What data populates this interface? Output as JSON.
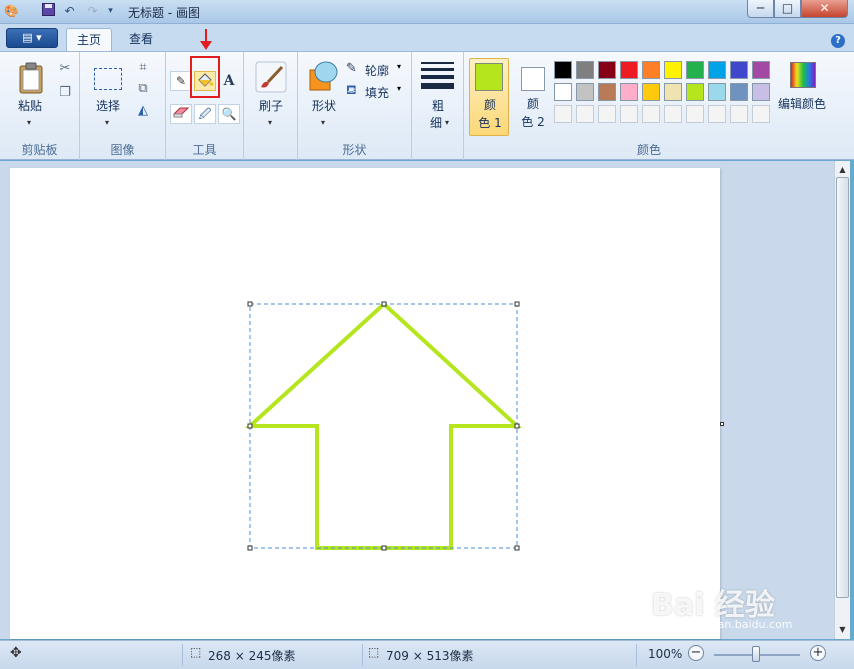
{
  "window": {
    "title": "无标题 - 画图",
    "min_glyph": "─",
    "max_glyph": "□",
    "close_glyph": "✕"
  },
  "quick_access": {
    "icons": [
      "paint-logo-icon",
      "save-icon",
      "undo-icon",
      "redo-icon",
      "dropdown-icon"
    ]
  },
  "tabs": {
    "app_menu": "▤ ▾",
    "home": "主页",
    "view": "查看",
    "help": "?"
  },
  "ribbon": {
    "clipboard": {
      "paste": "粘贴",
      "label": "剪贴板"
    },
    "image": {
      "select": "选择",
      "label": "图像"
    },
    "tools": {
      "label": "工具",
      "text_glyph": "A"
    },
    "brushes": {
      "label": "刷子"
    },
    "shapes": {
      "shapes_label": "形状",
      "outline": "轮廓",
      "fill": "填充",
      "group_label": "形状"
    },
    "size": {
      "label_line1": "粗",
      "label_line2": "细"
    },
    "colors": {
      "color1_line1": "颜",
      "color1_line2": "色 1",
      "color2_line1": "颜",
      "color2_line2": "色 2",
      "edit_colors": "编辑颜色",
      "group_label": "颜色",
      "color1_value": "#b5e61d",
      "color2_value": "#ffffff",
      "palette_row1": [
        "#000000",
        "#7f7f7f",
        "#880015",
        "#ed1c24",
        "#ff7f27",
        "#fff200",
        "#22b14c",
        "#00a2e8",
        "#3f48cc",
        "#a349a4"
      ],
      "palette_row2": [
        "#ffffff",
        "#c3c3c3",
        "#b97a57",
        "#ffaec9",
        "#ffc90e",
        "#efe4b0",
        "#b5e61d",
        "#99d9ea",
        "#7092be",
        "#c8bfe7"
      ],
      "palette_row3": [
        "#f4f4f4",
        "#f4f4f4",
        "#f4f4f4",
        "#f4f4f4",
        "#f4f4f4",
        "#f4f4f4",
        "#f4f4f4",
        "#f4f4f4",
        "#f4f4f4",
        "#f4f4f4"
      ]
    }
  },
  "status": {
    "selection_size": "268 × 245像素",
    "image_size": "709 × 513像素",
    "zoom": "100%",
    "zoom_out": "−",
    "zoom_in": "+"
  },
  "watermark": {
    "text": "Bai 经验",
    "url": "jingyan.baidu.com"
  }
}
